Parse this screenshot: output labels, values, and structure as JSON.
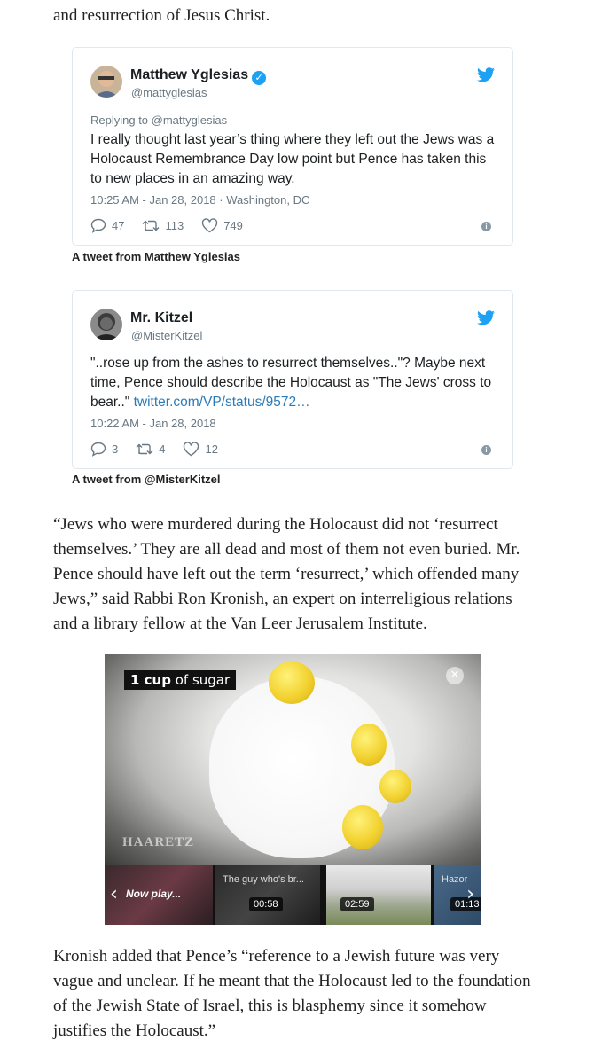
{
  "article": {
    "top_text": "and resurrection of Jesus Christ.",
    "quote_para": "“Jews who were murdered during the Holocaust did not ‘resurrect themselves.’ They are all dead and most of them not even buried. Mr. Pence should have left out the term ‘resurrect,’ which offended many Jews,” said Rabbi Ron Kronish, an expert on interreligious relations and a library fellow at the Van Leer Jerusalem Institute.",
    "bottom_para": "Kronish added that Pence’s “reference to a Jewish future was very vague and unclear. If he meant that the Holocaust led to the foundation of the Jewish State of Israel, this is blasphemy since it somehow justifies the Holocaust.”"
  },
  "tweets": [
    {
      "name": "Matthew Yglesias",
      "verified": true,
      "handle": "@mattyglesias",
      "reply": "Replying to @mattyglesias",
      "text": "I really thought last year’s thing where they left out the Jews was a Holocaust Remembrance Day low point but Pence has taken this to new places in an amazing way.",
      "link": "",
      "time": "10:25 AM - Jan 28, 2018 · Washington, DC",
      "replies": "47",
      "retweets": "113",
      "likes": "749",
      "caption": "A tweet from Matthew Yglesias"
    },
    {
      "name": "Mr. Kitzel",
      "verified": false,
      "handle": "@MisterKitzel",
      "text": "\"..rose up from the ashes to resurrect themselves..\"? Maybe next time, Pence should describe the Holocaust as \"The Jews' cross to bear..\"",
      "link": "twitter.com/VP/status/9572…",
      "time": "10:22 AM - Jan 28, 2018",
      "replies": "3",
      "retweets": "4",
      "likes": "12",
      "caption": "A tweet from @MisterKitzel"
    }
  ],
  "video": {
    "label_bold": "1 cup",
    "label_rest": " of sugar",
    "logo": "HAARETZ",
    "thumbs": [
      {
        "now_playing": "Now play..."
      },
      {
        "title": "The guy who's br...",
        "duration": "00:58"
      },
      {
        "duration": "02:59"
      },
      {
        "title": "Hazor",
        "duration": "01:13"
      }
    ]
  },
  "colors": {
    "twitter_blue": "#1da1f2",
    "link": "#2b7bb9",
    "muted": "#697882"
  }
}
